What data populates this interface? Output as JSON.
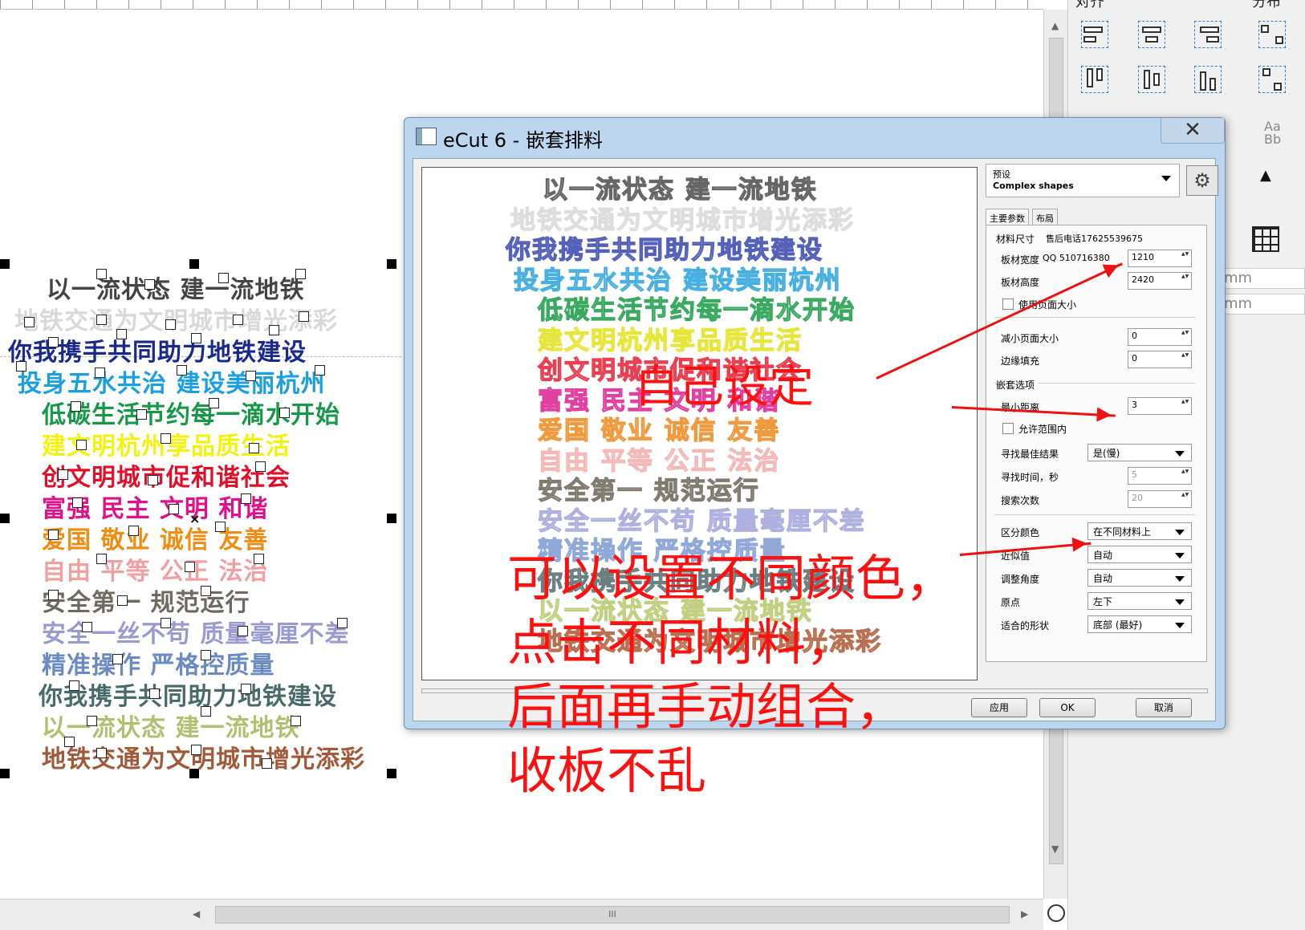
{
  "canvas": {
    "lines": [
      {
        "text": "以一流状态 建一流地铁",
        "color": "#444444"
      },
      {
        "text": "地铁交通为文明城市增光添彩",
        "color": "#d8d8d8"
      },
      {
        "text": "你我携手共同助力地铁建设",
        "color": "#1a2a8c"
      },
      {
        "text": "投身五水共治 建设美丽杭州",
        "color": "#1aa0e0"
      },
      {
        "text": "低碳生活节约每一滴水开始",
        "color": "#169848"
      },
      {
        "text": "建文明杭州享品质生活",
        "color": "#f2f20f"
      },
      {
        "text": "创文明城市促和谐社会",
        "color": "#e0102a"
      },
      {
        "text": "富强 民主 文明 和谐",
        "color": "#e0108a"
      },
      {
        "text": "爱国 敬业 诚信 友善",
        "color": "#f08c10"
      },
      {
        "text": "自由 平等 公正 法治",
        "color": "#f0a0a0"
      },
      {
        "text": "安全第一 规范运行",
        "color": "#6e6a62"
      },
      {
        "text": "安全一丝不苟 质量毫厘不差",
        "color": "#9a9ad0"
      },
      {
        "text": "精准操作 严格控质量",
        "color": "#6a8ac0"
      },
      {
        "text": "你我携手共同助力地铁建设",
        "color": "#4a6a6a"
      },
      {
        "text": "以一流状态 建一流地铁",
        "color": "#b0c070"
      },
      {
        "text": "地铁交通为文明城市增光添彩",
        "color": "#a05a3a"
      }
    ]
  },
  "right_panel": {
    "title_align": "对齐",
    "title_dist": "分布",
    "unit1": "mm",
    "unit2": "mm",
    "font_icon": "Aa Bb"
  },
  "dialog": {
    "title": "eCut 6 - 嵌套排料",
    "close_icon": "✕",
    "preview_lines": [
      {
        "text": "以一流状态 建一流地铁",
        "color": "#666666"
      },
      {
        "text": "地铁交通为文明城市增光添彩",
        "color": "#dddddd"
      },
      {
        "text": "你我携手共同助力地铁建设",
        "color": "#5560b8"
      },
      {
        "text": "投身五水共治 建设美丽杭州",
        "color": "#48b0e0"
      },
      {
        "text": "低碳生活节约每一滴水开始",
        "color": "#3aaa60"
      },
      {
        "text": "建文明杭州享品质生活",
        "color": "#e6e63a"
      },
      {
        "text": "创文明城市促和谐社会",
        "color": "#e84050"
      },
      {
        "text": "富强 民主 文明 和谐",
        "color": "#e040a0"
      },
      {
        "text": "爱国 敬业 诚信 友善",
        "color": "#f09a40"
      },
      {
        "text": "自由 平等 公正 法治",
        "color": "#f4b8b8"
      },
      {
        "text": "安全第一 规范运行",
        "color": "#807a70"
      },
      {
        "text": "安全一丝不苟 质量毫厘不差",
        "color": "#b0b0e0"
      },
      {
        "text": "精准操作 严格控质量",
        "color": "#90a8d8"
      },
      {
        "text": "你我携手共同助力地铁建设",
        "color": "#6a8080"
      },
      {
        "text": "以一流状态 建一流地铁",
        "color": "#c0d080"
      },
      {
        "text": "地铁交通为文明城市增光添彩",
        "color": "#b87050"
      }
    ],
    "preset_label": "预设",
    "preset_value": "Complex shapes",
    "tab_main": "主要参数",
    "tab_layout": "布局",
    "material_size": "材料尺寸",
    "hotline": "售后电话17625539675",
    "qq": "QQ 510716380",
    "sheet_width_label": "板材宽度",
    "sheet_width": "1210",
    "sheet_height_label": "板材高度",
    "sheet_height": "2420",
    "use_page_size": "使用页面大小",
    "reduce_page_label": "减小页面大小",
    "reduce_page": "0",
    "edge_fill_label": "边缘填充",
    "edge_fill": "0",
    "nest_options": "嵌套选项",
    "min_dist_label": "最小距离",
    "min_dist": "3",
    "allow_in_range": "允许范围内",
    "find_best_label": "寻找最佳结果",
    "find_best": "是(慢)",
    "find_time_label": "寻找时间，秒",
    "find_time": "5",
    "search_count_label": "搜索次数",
    "search_count": "20",
    "distinguish_label": "区分颜色",
    "distinguish": "在不同材料上",
    "approx_label": "近似值",
    "approx": "自动",
    "angle_label": "调整角度",
    "angle": "自动",
    "origin_label": "原点",
    "origin": "左下",
    "shape_label": "适合的形状",
    "shape": "底部 (最好)",
    "btn_apply": "应用",
    "btn_ok": "OK",
    "btn_cancel": "取消"
  },
  "annotations": {
    "self_set": "自己设定",
    "line1": "可以设置不同颜色，",
    "line2": "点击不同材料，",
    "line3": "后面再手动组合，",
    "line4": "收板不乱"
  },
  "scroll": {
    "thumb_grip": "III"
  }
}
